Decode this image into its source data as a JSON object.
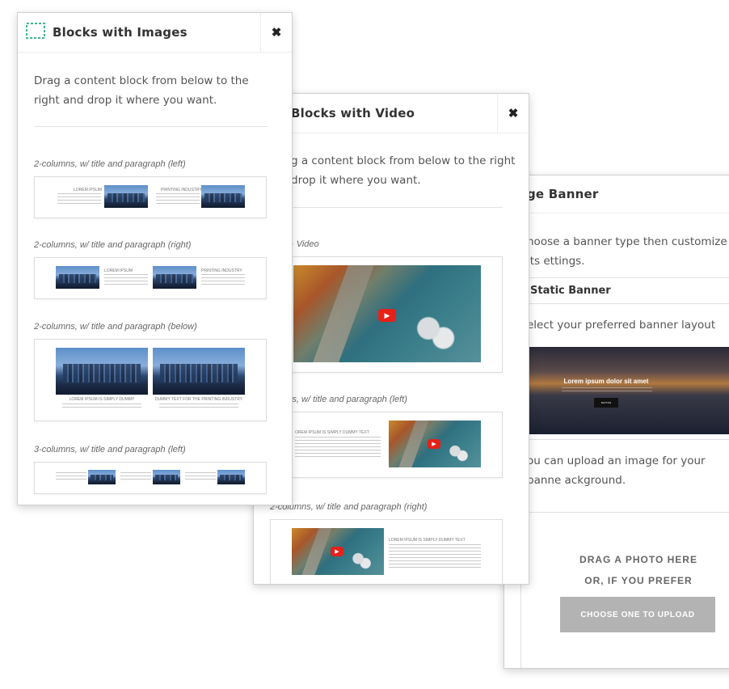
{
  "images_panel": {
    "title": "Blocks with Images",
    "close": "✖",
    "intro": "Drag a content block from below to the right and drop it where you want.",
    "blocks": [
      {
        "label": "2-columns, w/ title and paragraph (left)",
        "captions": [
          "LOREM IPSUM",
          "PRINTING INDUSTRY"
        ]
      },
      {
        "label": "2-columns, w/ title and paragraph (right)",
        "captions": [
          "LOREM IPSUM",
          "PRINTING INDUSTRY"
        ]
      },
      {
        "label": "2-columns, w/ title and paragraph (below)",
        "captions": [
          "LOREM IPSUM IS SIMPLY DUMMY",
          "DUMMY TEXT FOR THE PRINTING INDUSTRY"
        ]
      },
      {
        "label": "3-columns, w/ title and paragraph (left)"
      }
    ]
  },
  "video_panel": {
    "title": "Blocks with Video",
    "close": "✖",
    "intro": "g a content block from below to the right drop it where you want.",
    "blocks": [
      {
        "label": "· Video"
      },
      {
        "label": "umns, w/ title and paragraph (left)",
        "caption": "OREM IPSUM IS SIMPLY DUMMY TEXT"
      },
      {
        "label": "2-columns, w/ title and paragraph (right)",
        "caption": "LOREM IPSUM IS SIMPLY DUMMY TEXT"
      }
    ]
  },
  "banner_panel": {
    "title": "ge Banner",
    "intro": "hoose a banner type then customize its ettings.",
    "static_heading": "Static Banner",
    "layout_prompt": "elect your preferred banner layout",
    "preview_title": "Lorem ipsum dolor sit amet",
    "preview_button": "BUTTON",
    "upload_intro": "ou can upload an image for your banne ackground.",
    "drag_line1": "DRAG A PHOTO HERE",
    "drag_line2": "OR, IF YOU PREFER",
    "upload_button": "CHOOSE ONE TO UPLOAD"
  },
  "colors": {
    "accent": "#3db88b",
    "play": "#e62117",
    "upload_button": "#b3b3b3"
  }
}
